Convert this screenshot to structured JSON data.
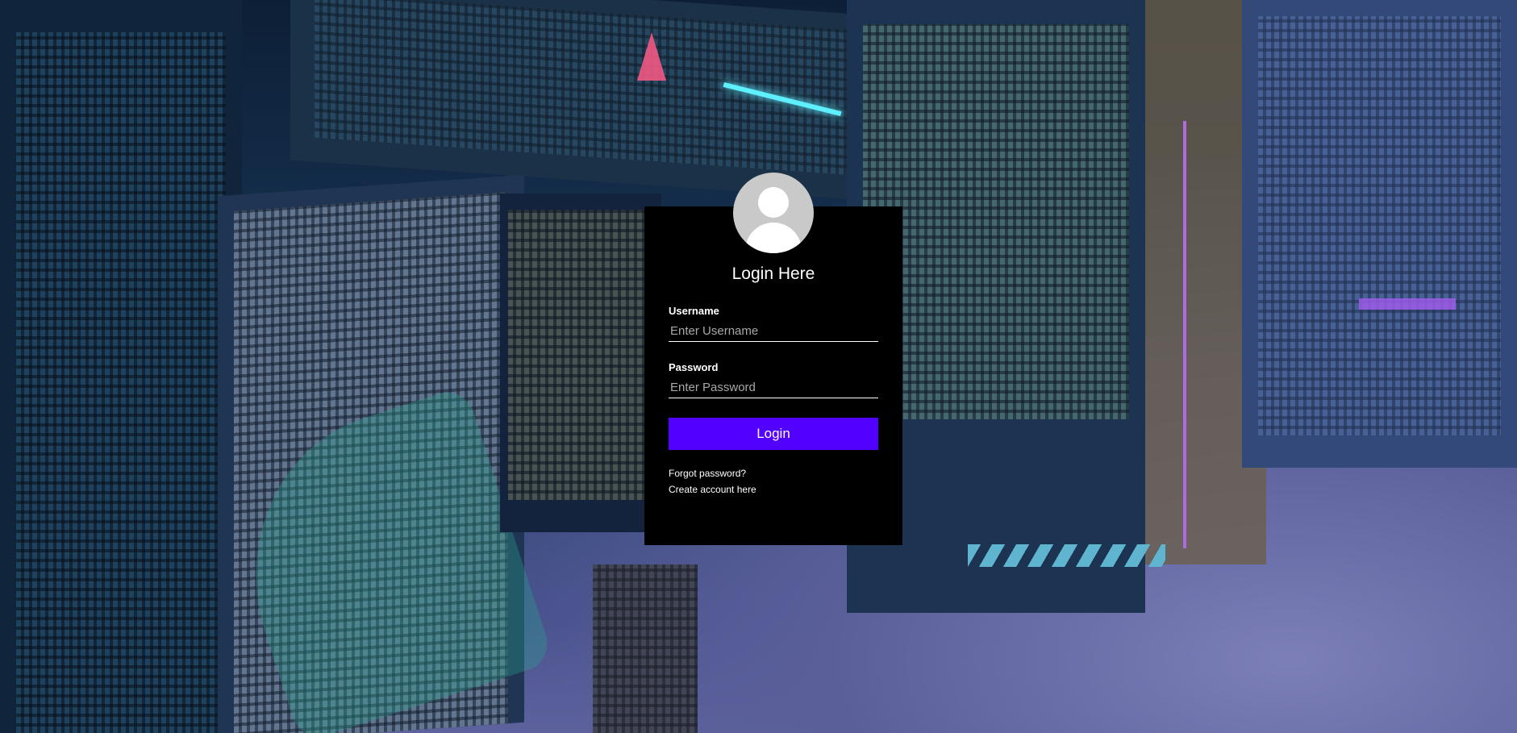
{
  "login": {
    "title": "Login Here",
    "username_label": "Username",
    "username_placeholder": "Enter Username",
    "password_label": "Password",
    "password_placeholder": "Enter Password",
    "login_button": "Login",
    "forgot_password": "Forgot password?",
    "create_account": "Create account here"
  },
  "icons": {
    "avatar": "user-avatar-icon"
  },
  "colors": {
    "card_background": "#000000",
    "button_accent": "#5200ff",
    "avatar_gray": "#c9c9c9",
    "text": "#ffffff"
  }
}
